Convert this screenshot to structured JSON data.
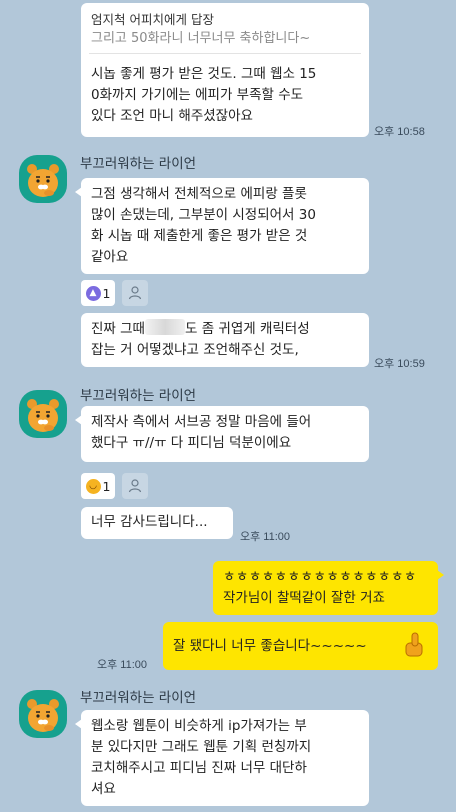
{
  "messages": {
    "m1": {
      "reply_header": "엄지척 어피치에게 답장",
      "reply_quote": "그리고 50화라니 너무너무 축하합니다~",
      "lines": [
        "시놉 좋게 평가 받은 것도. 그때 웹소 15",
        "0화까지 가기에는 에피가 부족할 수도",
        "있다 조언 마니 해주셨잖아요"
      ],
      "time": "오후 10:58"
    },
    "sender_name": "부끄러워하는 라이언",
    "m2": {
      "lines": [
        "그점 생각해서 전체적으로 에피랑 플롯",
        "많이 손댔는데, 그부분이 시정되어서 30",
        "화 시놉 때 제출한게 좋은 평가 받은 것",
        "같아요"
      ],
      "reaction_count": "1"
    },
    "m3": {
      "line1_before": "진짜 그때",
      "line1_after": "도 좀 귀엽게 캐릭터성",
      "line2": "잡는 거 어떻겠냐고 조언해주신 것도,",
      "time": "오후 10:59"
    },
    "m4": {
      "lines": [
        "제작사 측에서 서브공 정말 마음에 들어",
        "했다구 ㅠ//ㅠ 다 피디님 덕분이에요"
      ],
      "reaction_count": "1"
    },
    "m5": {
      "text": "너무 감사드립니다...",
      "time": "오후 11:00"
    },
    "m6": {
      "lines": [
        "ㅎㅎㅎㅎㅎㅎㅎㅎㅎㅎㅎㅎㅎㅎㅎ",
        "작가님이 찰떡같이 잘한 거죠"
      ]
    },
    "m7": {
      "text": "잘 됐다니 너무 좋습니다~~~~~",
      "time": "오후 11:00"
    },
    "m8": {
      "lines": [
        "웹소랑 웹툰이 비슷하게 ip가져가는 부",
        "분 있다지만 그래도 웹툰 기획 런칭까지",
        "코치해주시고 피디님 진짜 너무 대단하",
        "셔요"
      ]
    },
    "colors": {
      "background": "#b2c7d9",
      "my_bubble": "#fee500",
      "their_bubble": "#ffffff",
      "avatar_bg": "#16a18e"
    },
    "icons": {
      "avatar": "ryan-avatar-icon",
      "reaction_like": "thumbs-up-icon",
      "reaction_laugh": "laughing-emoji-icon",
      "add_reaction": "person-add-icon",
      "sticker": "thumbs-up-sticker-icon"
    }
  }
}
